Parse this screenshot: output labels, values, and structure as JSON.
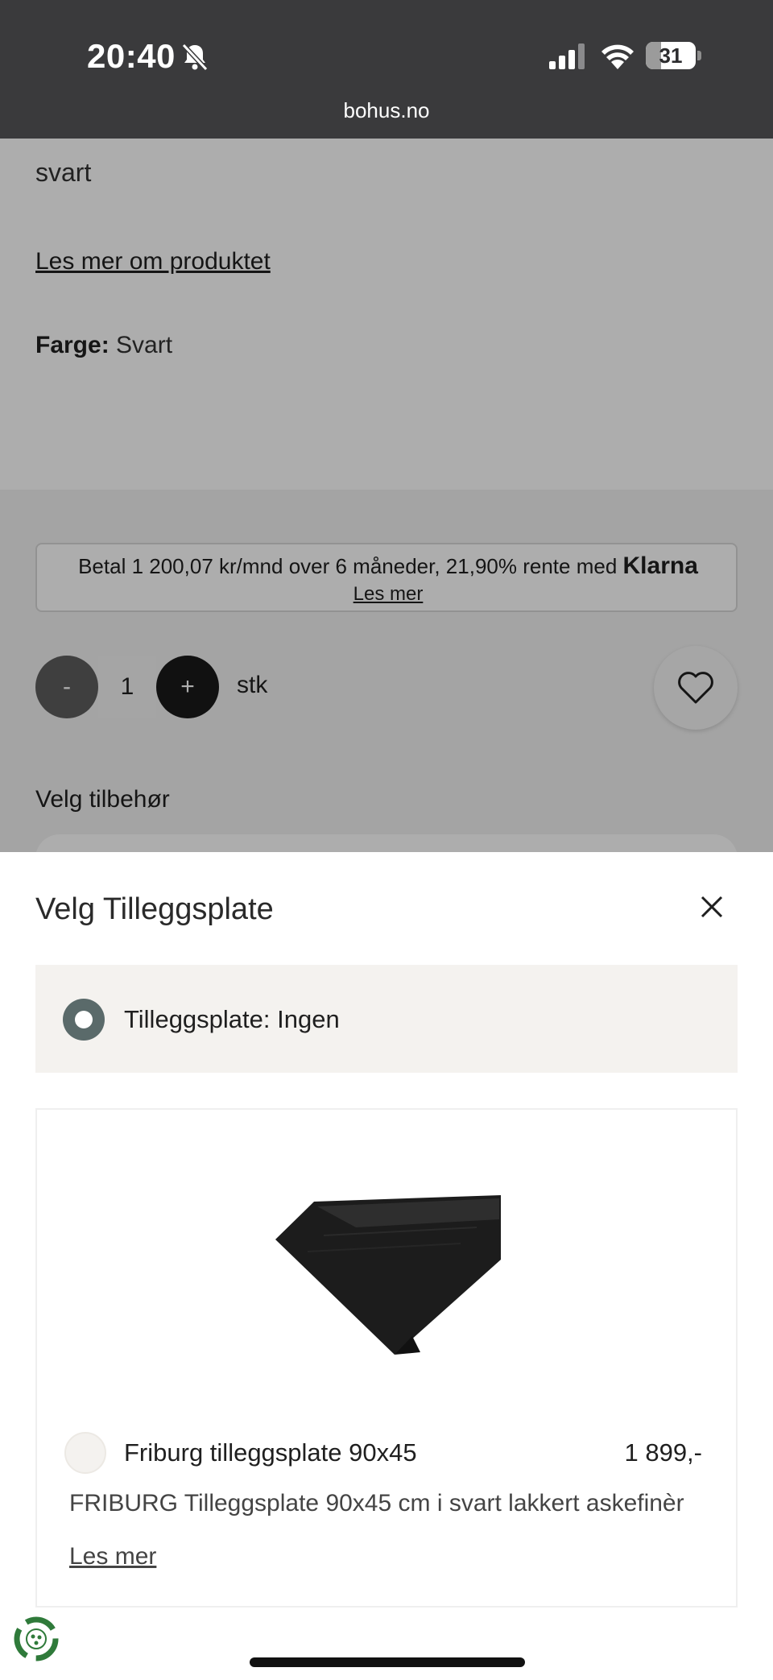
{
  "status_bar": {
    "time": "20:40",
    "battery": "31",
    "battery_level": 0.31,
    "url": "bohus.no"
  },
  "product": {
    "description_tail": "svart",
    "read_more": "Les mer om produktet",
    "color_label": "Farge:",
    "color_value": "Svart"
  },
  "klarna": {
    "text": "Betal 1 200,07 kr/mnd over 6 måneder, 21,90% rente med",
    "brand": "Klarna",
    "link": "Les mer"
  },
  "quantity": {
    "minus": "-",
    "value": "1",
    "plus": "+",
    "unit": "stk"
  },
  "accessories": {
    "title": "Velg tilbehør"
  },
  "sheet": {
    "title": "Velg Tilleggsplate",
    "option_none": "Tilleggsplate: Ingen",
    "items": [
      {
        "name": "Friburg tilleggsplate 90x45",
        "price": "1 899,-",
        "description": "FRIBURG Tilleggsplate 90x45 cm i svart lakkert askefinèr",
        "read_more": "Les mer"
      }
    ]
  },
  "colors": {
    "status_bar_bg": "#3a3a3c",
    "selected_radio": "#5a6a6a",
    "option_bg": "#f4f2ef"
  }
}
